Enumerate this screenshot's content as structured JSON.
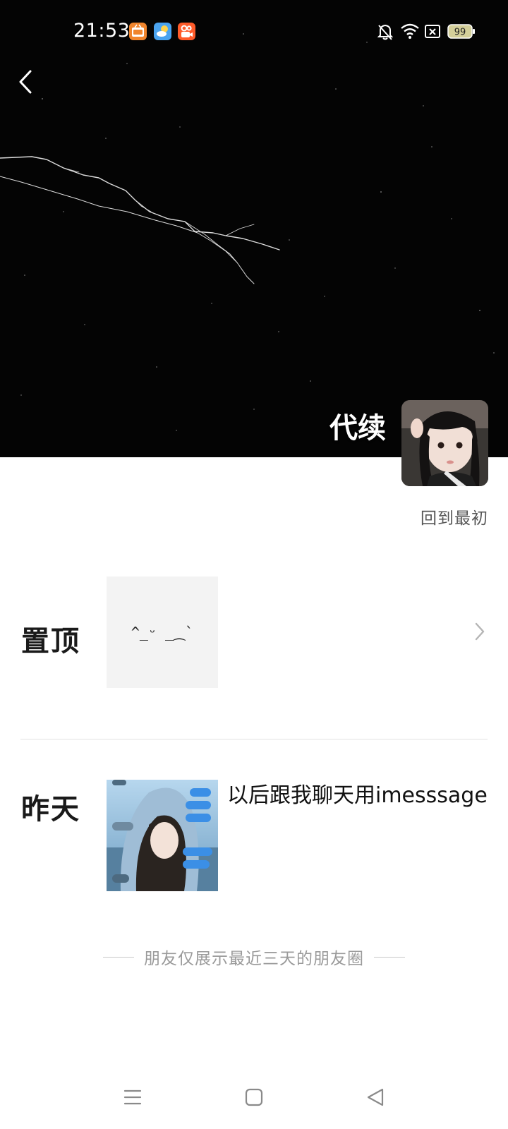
{
  "status_bar": {
    "time": "21:53",
    "battery_level": "99",
    "notification_icons": [
      "hot-video-app-icon",
      "weather-app-icon",
      "kuaishou-app-icon"
    ],
    "right_icons": [
      "bell-off-icon",
      "wifi-icon",
      "sim-blocked-icon",
      "battery-icon"
    ]
  },
  "profile": {
    "name": "代续",
    "back_to_start_label": "回到最初"
  },
  "pinned": {
    "label": "置顶",
    "thumb_text": "^_ᵕ _⁔`"
  },
  "moments": [
    {
      "date_label": "昨天",
      "text": "以后跟我聊天用imesssage"
    }
  ],
  "footer_note": "朋友仅展示最近三天的朋友圈",
  "colors": {
    "cover_bg": "#040404",
    "text_primary": "#1a1a1a",
    "text_secondary": "#555555",
    "text_muted": "#9a9a9a",
    "divider": "#e3e3e3"
  },
  "nav_bar": [
    "menu-icon",
    "home-icon",
    "back-triangle-icon"
  ]
}
